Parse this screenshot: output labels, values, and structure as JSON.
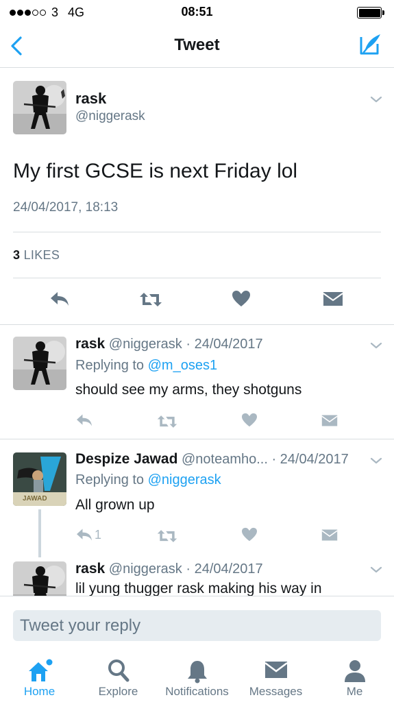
{
  "status": {
    "carrier": "3",
    "network": "4G",
    "time": "08:51"
  },
  "nav": {
    "title": "Tweet"
  },
  "main_tweet": {
    "name": "rask",
    "handle": "@niggerask",
    "text": "My first GCSE is next Friday lol",
    "timestamp": "24/04/2017, 18:13",
    "likes_count": "3",
    "likes_label": "LIKES"
  },
  "replies": [
    {
      "name": "rask",
      "meta": "@niggerask · 24/04/2017",
      "replying_prefix": "Replying to",
      "replying_to": "@m_oses1",
      "text": "should see my arms, they shotguns",
      "reply_count": ""
    },
    {
      "name": "Despize Jawad",
      "meta": "@noteamho... · 24/04/2017",
      "replying_prefix": "Replying to",
      "replying_to": "@niggerask",
      "text": "All grown up",
      "reply_count": "1",
      "avatar_label": "JAWAD"
    },
    {
      "name": "rask",
      "meta": "@niggerask · 24/04/2017",
      "text": "lil yung thugger rask making his way in"
    }
  ],
  "reply_bar": {
    "placeholder": "Tweet your reply"
  },
  "tabs": [
    {
      "label": "Home",
      "icon": "home-icon"
    },
    {
      "label": "Explore",
      "icon": "search-icon"
    },
    {
      "label": "Notifications",
      "icon": "bell-icon"
    },
    {
      "label": "Messages",
      "icon": "envelope-icon"
    },
    {
      "label": "Me",
      "icon": "person-icon"
    }
  ],
  "colors": {
    "accent": "#1da1f2",
    "muted": "#657786",
    "icon_gray": "#aab8c2",
    "divider": "#d8dde0"
  }
}
